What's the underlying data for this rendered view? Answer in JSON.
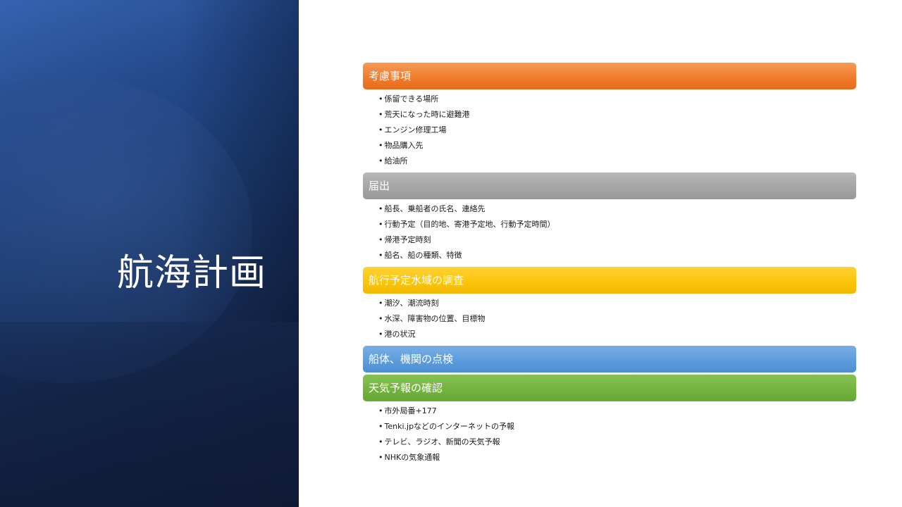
{
  "slide": {
    "title": "航海計画"
  },
  "sections": [
    {
      "header": "考慮事項",
      "color": "#ee7a2a",
      "items": [
        "係留できる場所",
        "荒天になった時に避難港",
        "エンジン修理工場",
        "物品購入先",
        "給油所"
      ]
    },
    {
      "header": "届出",
      "color": "#a4a4a4",
      "items": [
        "船長、乗船者の氏名、連絡先",
        "行動予定（目的地、寄港予定地、行動予定時間）",
        "帰港予定時刻",
        "船名、船の種類、特徴"
      ]
    },
    {
      "header": "航行予定水域の調査",
      "color": "#fbc40a",
      "items": [
        "潮汐、潮流時刻",
        "水深、障害物の位置、目標物",
        "港の状況"
      ]
    },
    {
      "header": "船体、機関の点検",
      "color": "#5b9bdb",
      "items": []
    },
    {
      "header": "天気予報の確認",
      "color": "#72b23e",
      "items": [
        "市外局番+177",
        "Tenki.jpなどのインターネットの予報",
        "テレビ、ラジオ、新聞の天気予報",
        "NHKの気象通報"
      ]
    }
  ]
}
